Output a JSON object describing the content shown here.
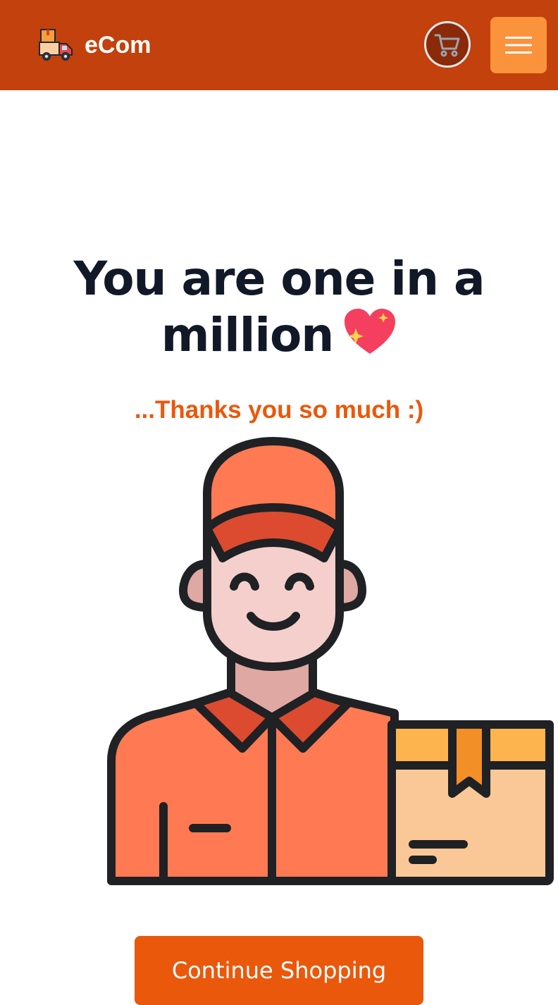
{
  "navbar": {
    "brand_name": "eCom",
    "brand_logo_icon": "delivery-truck-icon",
    "cart_icon": "shopping-cart-icon",
    "menu_icon": "hamburger-menu-icon",
    "background_color": "#c2410c",
    "menu_button_color": "#fb923c"
  },
  "main": {
    "headline": "You are one in a million",
    "headline_emoji_icon": "sparkling-heart-icon",
    "subline": "...Thanks you so much :)",
    "illustration_icon": "delivery-man-with-package-icon",
    "continue_button_label": "Continue Shopping",
    "accent_color": "#ea580c"
  }
}
